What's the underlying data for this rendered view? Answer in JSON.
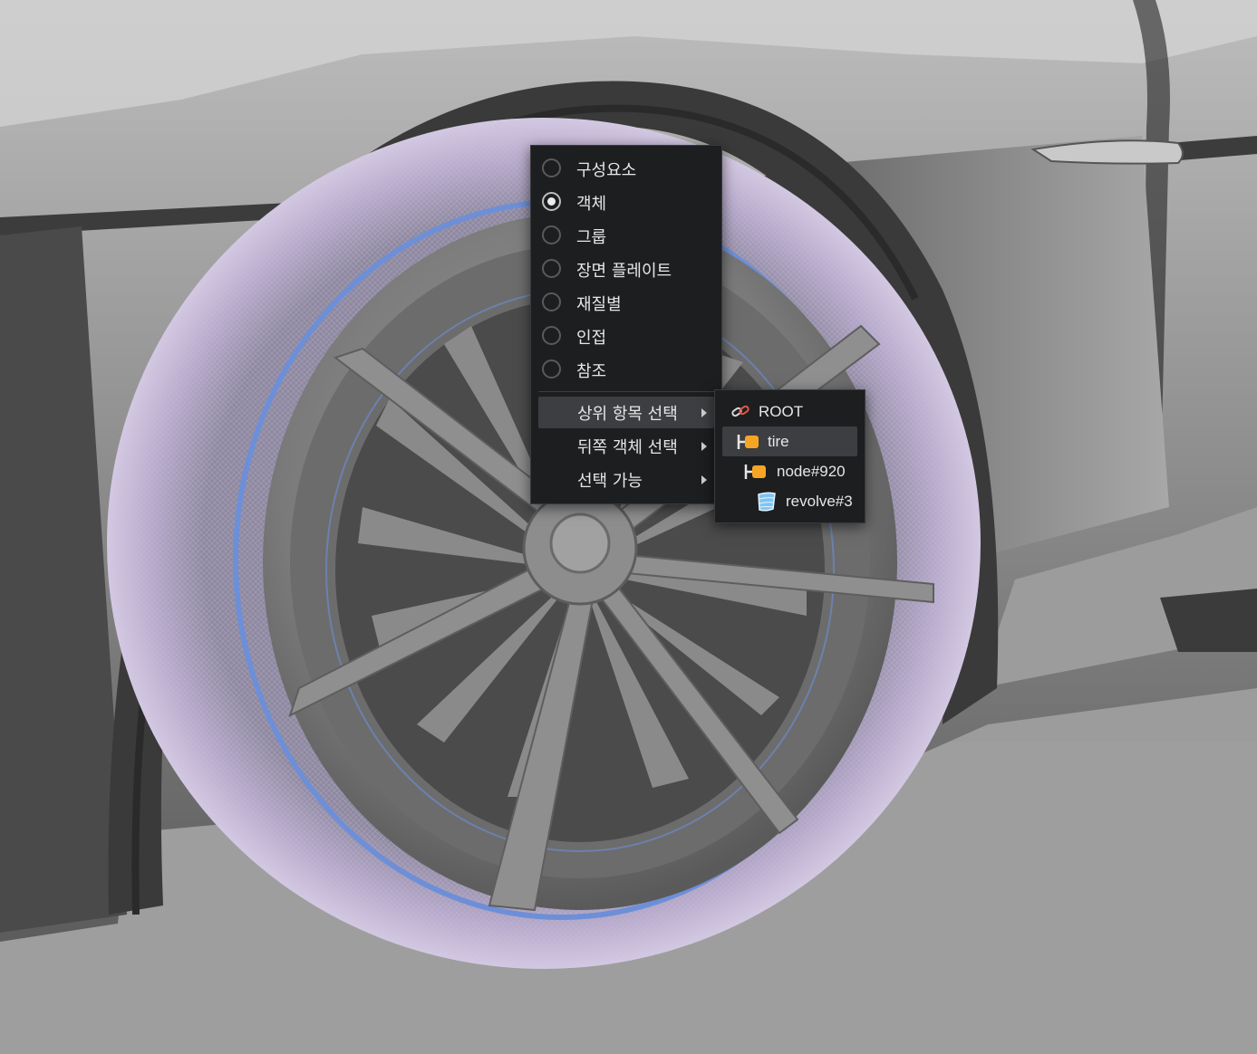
{
  "context_menu": {
    "selection_modes": [
      {
        "label": "구성요소",
        "checked": false
      },
      {
        "label": "객체",
        "checked": true
      },
      {
        "label": "그룹",
        "checked": false
      },
      {
        "label": "장면 플레이트",
        "checked": false
      },
      {
        "label": "재질별",
        "checked": false
      },
      {
        "label": "인접",
        "checked": false
      },
      {
        "label": "참조",
        "checked": false
      }
    ],
    "submenus": [
      {
        "label": "상위 항목 선택",
        "active": true
      },
      {
        "label": "뒤쪽 객체 선택",
        "active": false
      },
      {
        "label": "선택 가능",
        "active": false
      }
    ]
  },
  "parent_submenu": {
    "items": [
      {
        "label": "ROOT",
        "icon": "link-icon"
      },
      {
        "label": "tire",
        "icon": "group-node-icon",
        "active": true
      },
      {
        "label": "node#920",
        "icon": "group-node-icon"
      },
      {
        "label": "revolve#3",
        "icon": "mesh-surface-icon"
      }
    ]
  },
  "colors": {
    "menu_bg": "#1d1e20",
    "menu_highlight": "#3d3e41",
    "node_orange": "#f5a524",
    "mesh_blue": "#6d8fd8",
    "tire_lavender": "#a99bc2"
  }
}
